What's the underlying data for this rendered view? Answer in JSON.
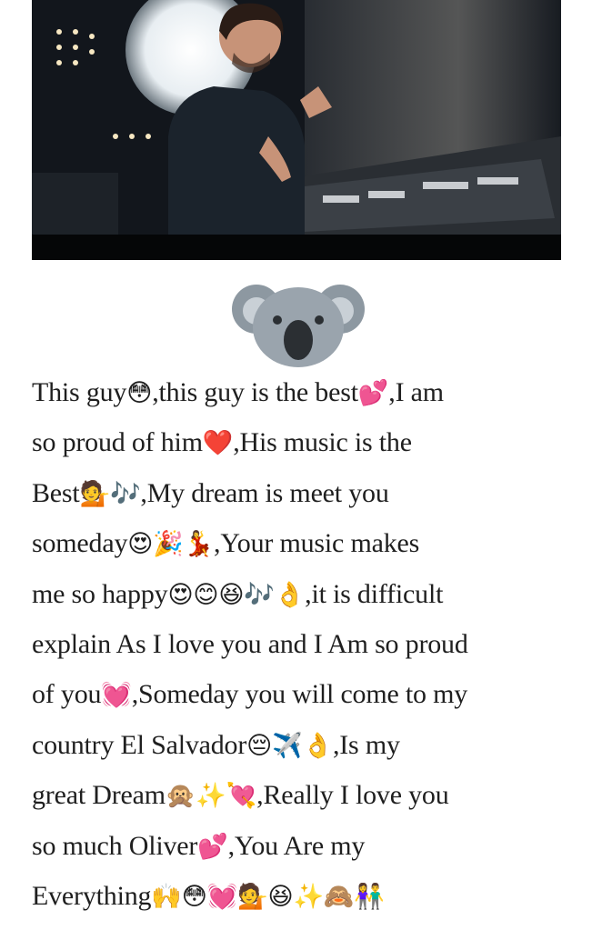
{
  "post": {
    "image_alt_icon": "koala-icon",
    "caption_lines": [
      [
        "This guy",
        "😳",
        ",this guy is the best",
        "💕",
        ",I am"
      ],
      [
        "so proud of him",
        "❤️",
        ",His music is the"
      ],
      [
        "Best",
        "💁",
        "🎶",
        ",My dream is meet you"
      ],
      [
        "someday",
        "😍",
        "🎉",
        "💃",
        ",Your music makes"
      ],
      [
        "me so happy",
        "😍",
        "😊",
        "😆",
        "🎶",
        "👌",
        ",it is difficult"
      ],
      [
        "explain As I love you and I Am so proud"
      ],
      [
        "of you",
        "💓",
        ",Someday you will come to my"
      ],
      [
        "country El Salvador",
        "😔",
        "✈️",
        "👌",
        ",Is my"
      ],
      [
        "great Dream",
        "🙊",
        "✨",
        "💘",
        ",Really I love you"
      ],
      [
        "so much Oliver",
        "💕",
        ",You Are my"
      ],
      [
        "Everything",
        "🙌",
        "😳",
        "💓",
        "💁",
        "😆",
        "✨",
        "🙈",
        "👫"
      ]
    ]
  },
  "colors": {
    "text": "#1f1f1f",
    "photo_bg": "#0c0f14",
    "koala_fur": "#9aa4ad",
    "koala_dark": "#2b2f33"
  }
}
